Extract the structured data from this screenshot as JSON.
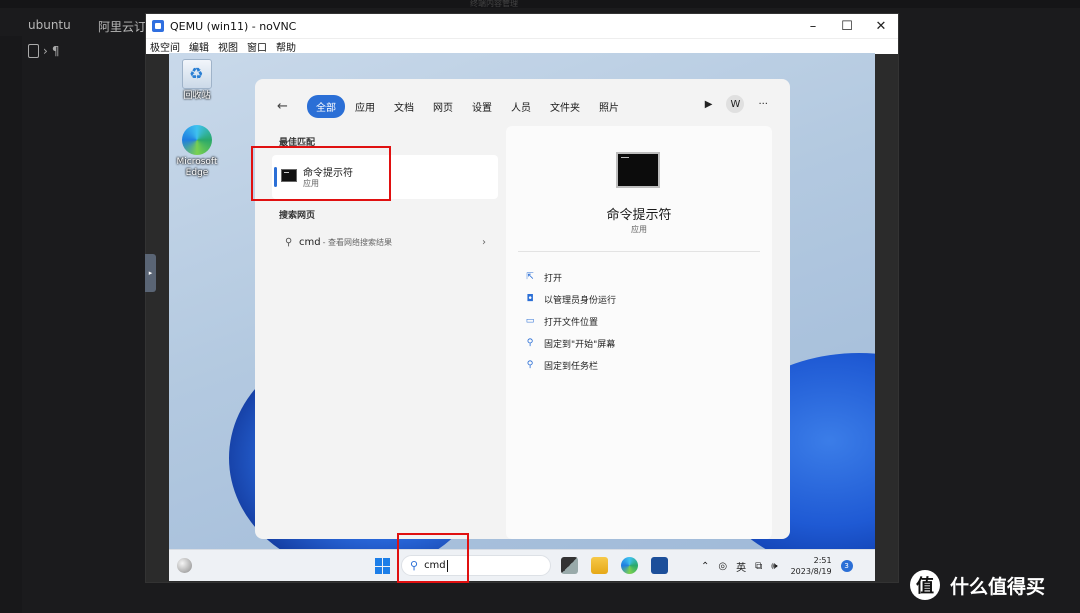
{
  "host": {
    "window_title": "终端内容管理",
    "tabs": [
      "ubuntu",
      "阿里云订"
    ],
    "toolbar_glyph": "¶"
  },
  "vnc": {
    "title": "QEMU (win11) - noVNC",
    "controls": [
      "–",
      "☐",
      "✕"
    ],
    "menu": [
      "极空间",
      "编辑",
      "视图",
      "窗口",
      "帮助"
    ],
    "handle_glyph": "▸"
  },
  "desktop": {
    "icons": [
      {
        "name": "回收站",
        "icon": "recycle-bin-icon"
      },
      {
        "name": "Microsoft Edge",
        "icon": "edge-icon"
      }
    ]
  },
  "search_panel": {
    "back_glyph": "←",
    "tabs": [
      "全部",
      "应用",
      "文档",
      "网页",
      "设置",
      "人员",
      "文件夹",
      "照片"
    ],
    "active_tab": 0,
    "play_glyph": "▶",
    "avatar_letter": "W",
    "more_glyph": "···",
    "best_match_header": "最佳匹配",
    "best_match": {
      "name": "命令提示符",
      "type": "应用"
    },
    "web_header": "搜索网页",
    "web_result": {
      "query": "cmd",
      "hint": "- 查看网络搜索结果",
      "chevron": "›"
    },
    "detail": {
      "name": "命令提示符",
      "type": "应用",
      "actions": [
        {
          "icon": "open-icon",
          "glyph": "⇱",
          "label": "打开"
        },
        {
          "icon": "admin-shield-icon",
          "glyph": "◘",
          "label": "以管理员身份运行"
        },
        {
          "icon": "folder-icon",
          "glyph": "▭",
          "label": "打开文件位置"
        },
        {
          "icon": "pin-icon",
          "glyph": "⚲",
          "label": "固定到\"开始\"屏幕"
        },
        {
          "icon": "pin-icon",
          "glyph": "⚲",
          "label": "固定到任务栏"
        }
      ]
    }
  },
  "taskbar": {
    "search_glyph": "⚲",
    "search_value": "cmd",
    "tray": {
      "chevron": "⌃",
      "ime": "英",
      "clock_time": "2:51",
      "clock_date": "2023/8/19",
      "notification_count": "3"
    }
  },
  "watermark": {
    "logo_glyph": "值",
    "text": "什么值得买"
  },
  "colors": {
    "accent": "#2b6fd6",
    "highlight": "#e01010",
    "host_bg": "#1b1b1d"
  }
}
